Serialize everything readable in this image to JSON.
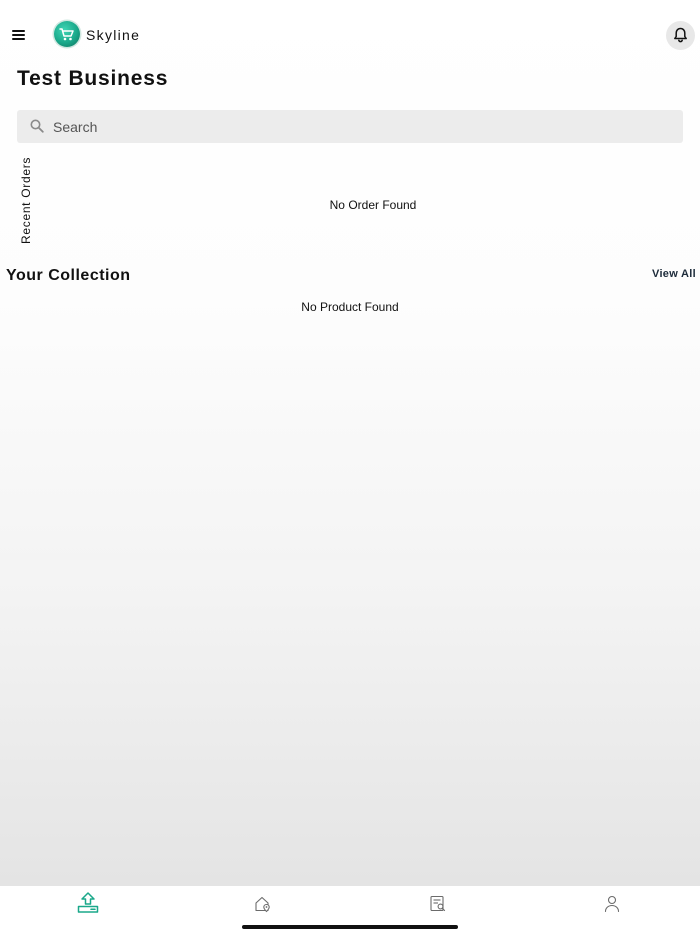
{
  "header": {
    "app_name": "Skyline",
    "menu_icon": "hamburger-menu-icon",
    "logo_icon": "shopping-cart-logo-icon",
    "notification_icon": "bell-icon"
  },
  "page": {
    "title": "Test Business"
  },
  "search": {
    "placeholder": "Search",
    "value": "",
    "icon": "search-icon"
  },
  "recent_orders": {
    "label": "Recent Orders",
    "empty_text": "No Order Found"
  },
  "collection": {
    "title": "Your Collection",
    "view_all_label": "View All",
    "empty_text": "No Product Found"
  },
  "tabbar": {
    "active_color": "#1aa88a",
    "inactive_color": "#6b6b6b",
    "tabs": [
      {
        "icon": "upload-box-icon",
        "active": true
      },
      {
        "icon": "home-location-icon",
        "active": false
      },
      {
        "icon": "order-search-icon",
        "active": false
      },
      {
        "icon": "profile-icon",
        "active": false
      }
    ]
  }
}
